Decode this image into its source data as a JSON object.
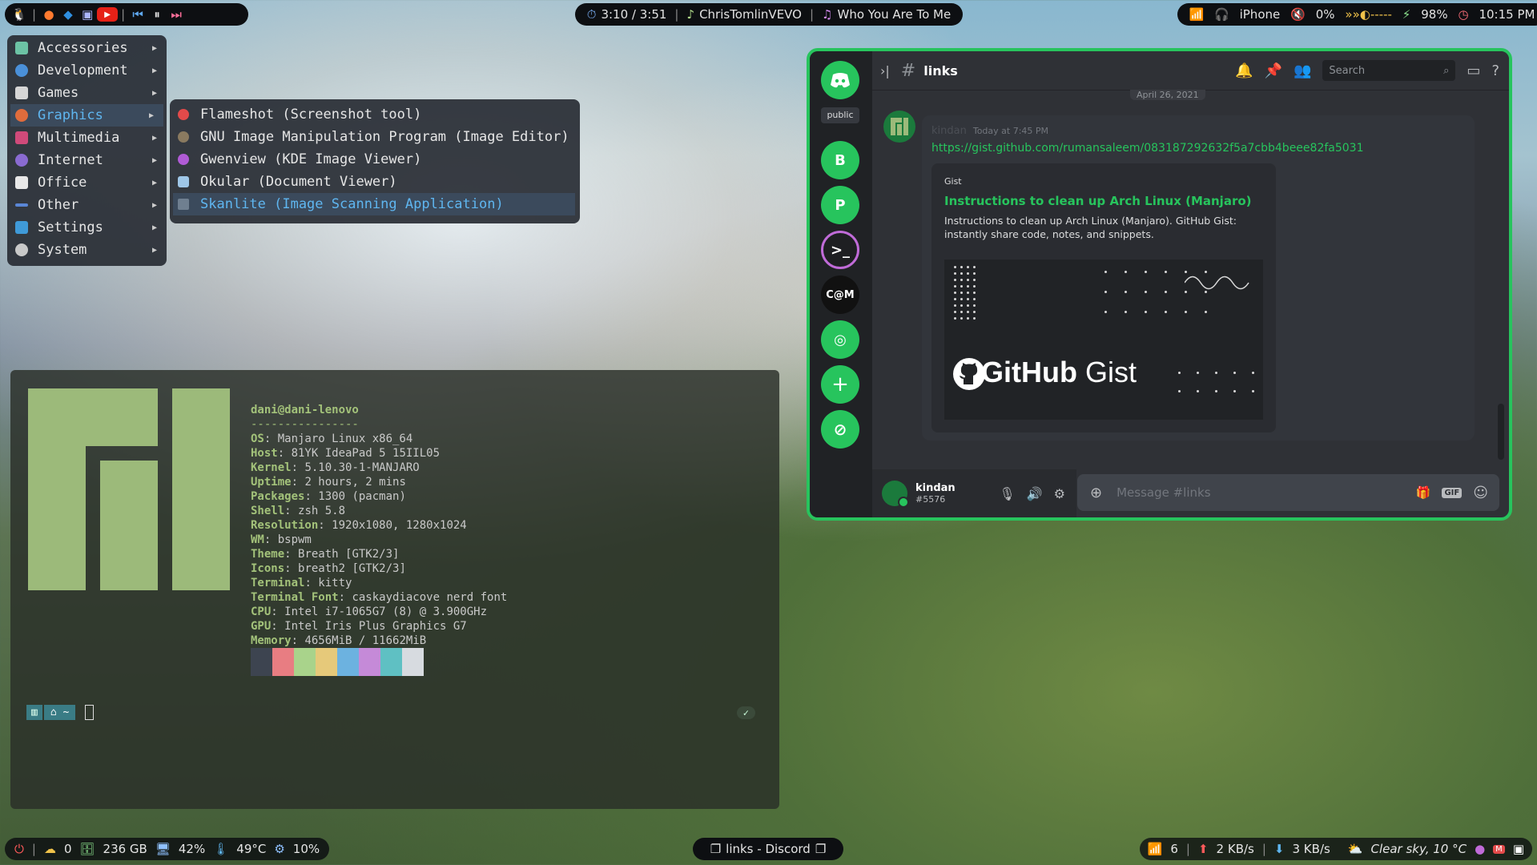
{
  "topbar": {
    "media": {
      "time": "3:10 / 3:51",
      "artist": "ChrisTomlinVEVO",
      "song": "Who You Are To Me"
    },
    "status": {
      "device": "iPhone",
      "volume": "0%",
      "brightness": "»»◐-----",
      "battery": "98%",
      "clock": "10:15 PM"
    }
  },
  "menu": {
    "items": [
      {
        "label": "Accessories",
        "icon": "accessories-icon",
        "color": "#6cc3a5"
      },
      {
        "label": "Development",
        "icon": "development-icon",
        "color": "#4a90d9"
      },
      {
        "label": "Games",
        "icon": "games-icon",
        "color": "#d6d6d6"
      },
      {
        "label": "Graphics",
        "icon": "graphics-icon",
        "color": "#e06c3c"
      },
      {
        "label": "Multimedia",
        "icon": "multimedia-icon",
        "color": "#d04a7a"
      },
      {
        "label": "Internet",
        "icon": "internet-icon",
        "color": "#8a6bd1"
      },
      {
        "label": "Office",
        "icon": "office-icon",
        "color": "#e8e8e8"
      },
      {
        "label": "Other",
        "icon": "other-icon",
        "color": "#5a86d6"
      },
      {
        "label": "Settings",
        "icon": "settings-icon",
        "color": "#3f9ad8"
      },
      {
        "label": "System",
        "icon": "system-icon",
        "color": "#c9c9c9"
      }
    ],
    "active_index": 3,
    "submenu": [
      {
        "label": "Flameshot (Screenshot tool)",
        "color": "#e24a4a"
      },
      {
        "label": "GNU Image Manipulation Program (Image Editor)",
        "color": "#8a7a60"
      },
      {
        "label": "Gwenview (KDE Image Viewer)",
        "color": "#b05bd6"
      },
      {
        "label": "Okular (Document Viewer)",
        "color": "#9fc7e8"
      },
      {
        "label": "Skanlite (Image Scanning Application)",
        "color": "#6f7f90"
      }
    ]
  },
  "terminal": {
    "user": "dani@dani-lenovo",
    "underline": "----------------",
    "info": [
      {
        "k": "OS",
        "v": "Manjaro Linux x86_64"
      },
      {
        "k": "Host",
        "v": "81YK IdeaPad 5 15IIL05"
      },
      {
        "k": "Kernel",
        "v": "5.10.30-1-MANJARO"
      },
      {
        "k": "Uptime",
        "v": "2 hours, 2 mins"
      },
      {
        "k": "Packages",
        "v": "1300 (pacman)"
      },
      {
        "k": "Shell",
        "v": "zsh 5.8"
      },
      {
        "k": "Resolution",
        "v": "1920x1080, 1280x1024"
      },
      {
        "k": "WM",
        "v": "bspwm"
      },
      {
        "k": "Theme",
        "v": "Breath [GTK2/3]"
      },
      {
        "k": "Icons",
        "v": "breath2 [GTK2/3]"
      },
      {
        "k": "Terminal",
        "v": "kitty"
      },
      {
        "k": "Terminal Font",
        "v": "caskaydiacove nerd font"
      },
      {
        "k": "CPU",
        "v": "Intel i7-1065G7 (8) @ 3.900GHz"
      },
      {
        "k": "GPU",
        "v": "Intel Iris Plus Graphics G7"
      },
      {
        "k": "Memory",
        "v": "4656MiB / 11662MiB"
      }
    ],
    "palette": [
      "#3d4450",
      "#e87d82",
      "#a9d38b",
      "#e6c97a",
      "#6cb2e0",
      "#c58ad8",
      "#5fc0c3",
      "#d7dbe0"
    ],
    "prompt_dir": "~",
    "check": "✓"
  },
  "discord": {
    "channel": "links",
    "search_placeholder": "Search",
    "date_divider": "April 26, 2021",
    "server_label": "public",
    "servers": [
      {
        "label": "B",
        "color": "#27c45d"
      },
      {
        "label": "P",
        "color": "#27c45d"
      },
      {
        "label": ">_",
        "color": "#1e1f22"
      },
      {
        "label": "C@M",
        "color": "#111"
      },
      {
        "label": "",
        "color": "#27c45d"
      }
    ],
    "message": {
      "author": "kindan",
      "timestamp": "Today at 7:45 PM",
      "link": "https://gist.github.com/rumansaleem/083187292632f5a7cbb4beee82fa5031",
      "embed": {
        "provider": "Gist",
        "title": "Instructions to clean up Arch Linux (Manjaro)",
        "description": "Instructions to clean up Arch Linux (Manjaro). GitHub Gist: instantly share code, notes, and snippets.",
        "image_brand": "GitHub",
        "image_word": "Gist"
      }
    },
    "user": {
      "name": "kindan",
      "tag": "#5576"
    },
    "composer_placeholder": "Message #links",
    "accent": "#27c45d"
  },
  "bottombar": {
    "updates": "0",
    "disk": "236 GB",
    "cpu_load": "42%",
    "temp": "49°C",
    "cpu_usage": "10%",
    "window_title": "links - Discord",
    "signal": "6",
    "upload": "2 KB/s",
    "download": "3 KB/s",
    "weather": "Clear sky, 10 °C"
  }
}
